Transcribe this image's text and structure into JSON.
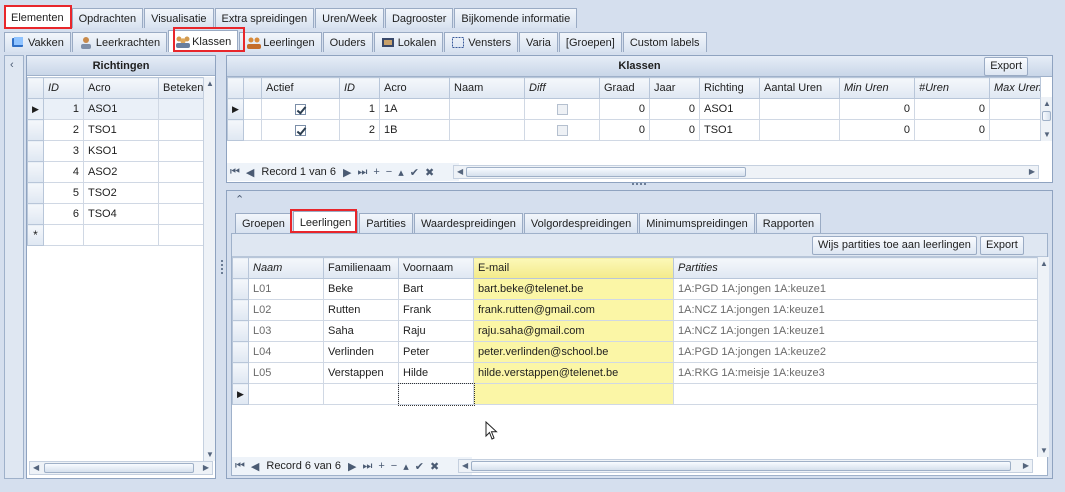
{
  "top_tabs": [
    {
      "label": "Elementen",
      "active": true
    },
    {
      "label": "Opdrachten"
    },
    {
      "label": "Visualisatie"
    },
    {
      "label": "Extra spreidingen"
    },
    {
      "label": "Uren/Week"
    },
    {
      "label": "Dagrooster"
    },
    {
      "label": "Bijkomende informatie"
    }
  ],
  "element_tabs": [
    {
      "label": "Vakken",
      "icon": "book-icon"
    },
    {
      "label": "Leerkrachten",
      "icon": "teacher-icon"
    },
    {
      "label": "Klassen",
      "icon": "class-group-icon",
      "active": true
    },
    {
      "label": "Leerlingen",
      "icon": "students-icon"
    },
    {
      "label": "Ouders"
    },
    {
      "label": "Lokalen",
      "icon": "classroom-icon"
    },
    {
      "label": "Vensters",
      "icon": "window-icon"
    },
    {
      "label": "Varia"
    },
    {
      "label": "[Groepen]"
    },
    {
      "label": "Custom labels"
    }
  ],
  "richtingen": {
    "title": "Richtingen",
    "columns": [
      "ID",
      "Acro",
      "Betekenis"
    ],
    "rows": [
      {
        "id": "1",
        "acro": "ASO1",
        "betekenis": ""
      },
      {
        "id": "2",
        "acro": "TSO1",
        "betekenis": ""
      },
      {
        "id": "3",
        "acro": "KSO1",
        "betekenis": ""
      },
      {
        "id": "4",
        "acro": "ASO2",
        "betekenis": ""
      },
      {
        "id": "5",
        "acro": "TSO2",
        "betekenis": ""
      },
      {
        "id": "6",
        "acro": "TSO4",
        "betekenis": ""
      }
    ],
    "new_row_marker": "*"
  },
  "klassen": {
    "title": "Klassen",
    "export_label": "Export",
    "columns": [
      "Actief",
      "ID",
      "Acro",
      "Naam",
      "Diff",
      "Graad",
      "Jaar",
      "Richting",
      "Aantal Uren",
      "Min Uren",
      "#Uren",
      "Max Uren"
    ],
    "rows": [
      {
        "actief": true,
        "id": "1",
        "acro": "1A",
        "naam": "",
        "diff": false,
        "graad": "0",
        "jaar": "0",
        "richting": "ASO1",
        "aantal_uren": "",
        "min_uren": "0",
        "uren": "0",
        "max_uren": ""
      },
      {
        "actief": true,
        "id": "2",
        "acro": "1B",
        "naam": "",
        "diff": false,
        "graad": "0",
        "jaar": "0",
        "richting": "TSO1",
        "aantal_uren": "",
        "min_uren": "0",
        "uren": "0",
        "max_uren": ""
      }
    ],
    "record_label": "Record 1 van 6"
  },
  "sub_tabs": [
    {
      "label": "Groepen"
    },
    {
      "label": "Leerlingen",
      "active": true
    },
    {
      "label": "Partities"
    },
    {
      "label": "Waardespreidingen"
    },
    {
      "label": "Volgordespreidingen"
    },
    {
      "label": "Minimumspreidingen"
    },
    {
      "label": "Rapporten"
    }
  ],
  "leerlingen": {
    "wijs_button": "Wijs partities toe aan leerlingen",
    "export_label": "Export",
    "columns": [
      "Naam",
      "Familienaam",
      "Voornaam",
      "E-mail",
      "Partities"
    ],
    "rows": [
      {
        "naam": "L01",
        "familienaam": "Beke",
        "voornaam": "Bart",
        "email": "bart.beke@telenet.be",
        "partities": "1A:PGD 1A:jongen 1A:keuze1"
      },
      {
        "naam": "L02",
        "familienaam": "Rutten",
        "voornaam": "Frank",
        "email": "frank.rutten@gmail.com",
        "partities": "1A:NCZ 1A:jongen 1A:keuze1"
      },
      {
        "naam": "L03",
        "familienaam": "Saha",
        "voornaam": "Raju",
        "email": "raju.saha@gmail.com",
        "partities": "1A:NCZ 1A:jongen 1A:keuze1"
      },
      {
        "naam": "L04",
        "familienaam": "Verlinden",
        "voornaam": "Peter",
        "email": "peter.verlinden@school.be",
        "partities": "1A:PGD 1A:jongen 1A:keuze2"
      },
      {
        "naam": "L05",
        "familienaam": "Verstappen",
        "voornaam": "Hilde",
        "email": "hilde.verstappen@telenet.be",
        "partities": "1A:RKG 1A:meisje 1A:keuze3"
      }
    ],
    "record_label": "Record 6 van 6"
  },
  "colors": {
    "highlight_red": "#e8262b",
    "email_yellow": "#fbf6a6",
    "panel_blue": "#d5dfee"
  }
}
